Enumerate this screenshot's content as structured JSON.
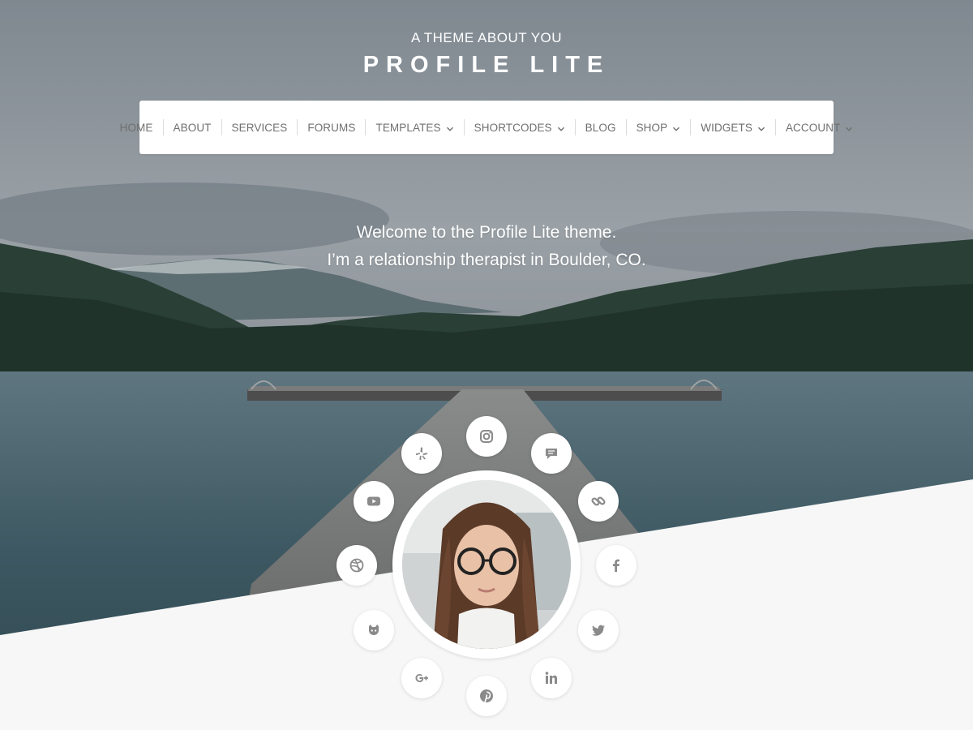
{
  "site": {
    "description": "A THEME ABOUT YOU",
    "title": "PROFILE LITE"
  },
  "nav": {
    "items": [
      {
        "label": "HOME",
        "dropdown": false
      },
      {
        "label": "ABOUT",
        "dropdown": false
      },
      {
        "label": "SERVICES",
        "dropdown": false
      },
      {
        "label": "FORUMS",
        "dropdown": false
      },
      {
        "label": "TEMPLATES",
        "dropdown": true
      },
      {
        "label": "SHORTCODES",
        "dropdown": true
      },
      {
        "label": "BLOG",
        "dropdown": false
      },
      {
        "label": "SHOP",
        "dropdown": true
      },
      {
        "label": "WIDGETS",
        "dropdown": true
      },
      {
        "label": "ACCOUNT",
        "dropdown": true
      }
    ]
  },
  "intro": {
    "line1": "Welcome to the Profile Lite theme.",
    "line2": "I’m a relationship therapist in Boulder, CO."
  },
  "social_icons": [
    "instagram-icon",
    "chat-icon",
    "link-icon",
    "facebook-icon",
    "twitter-icon",
    "linkedin-icon",
    "pinterest-icon",
    "google-plus-icon",
    "github-icon",
    "dribbble-icon",
    "youtube-icon",
    "yelp-icon"
  ],
  "colors": {
    "nav_text": "#6f6f6f",
    "icon": "#8a8a8a",
    "page_bg": "#f7f7f7"
  }
}
